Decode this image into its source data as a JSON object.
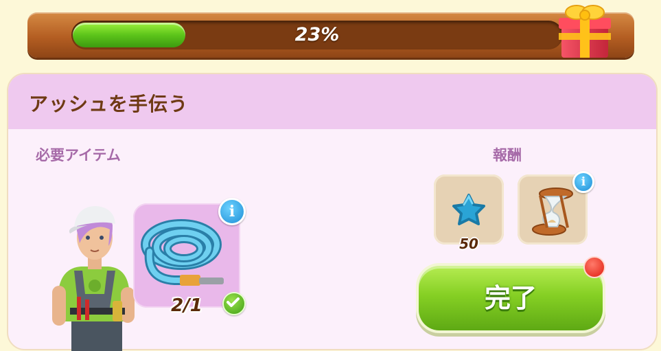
{
  "progress": {
    "value": 23,
    "label": "23%"
  },
  "quest": {
    "title": "アッシュを手伝う",
    "required_label": "必要アイテム",
    "required_item": {
      "icon": "garden-hose-icon",
      "count": "2/1",
      "completed": true
    },
    "reward_label": "報酬",
    "rewards": [
      {
        "icon": "blue-star-icon",
        "value": "50"
      },
      {
        "icon": "hourglass-icon",
        "value": ""
      }
    ],
    "complete_button": "完了"
  },
  "colors": {
    "progress_fill": "#5cc41a",
    "panel_header": "#efc9ef",
    "title_text": "#6e3a14",
    "section_label": "#a66aa8",
    "button_green": "#86d024"
  }
}
